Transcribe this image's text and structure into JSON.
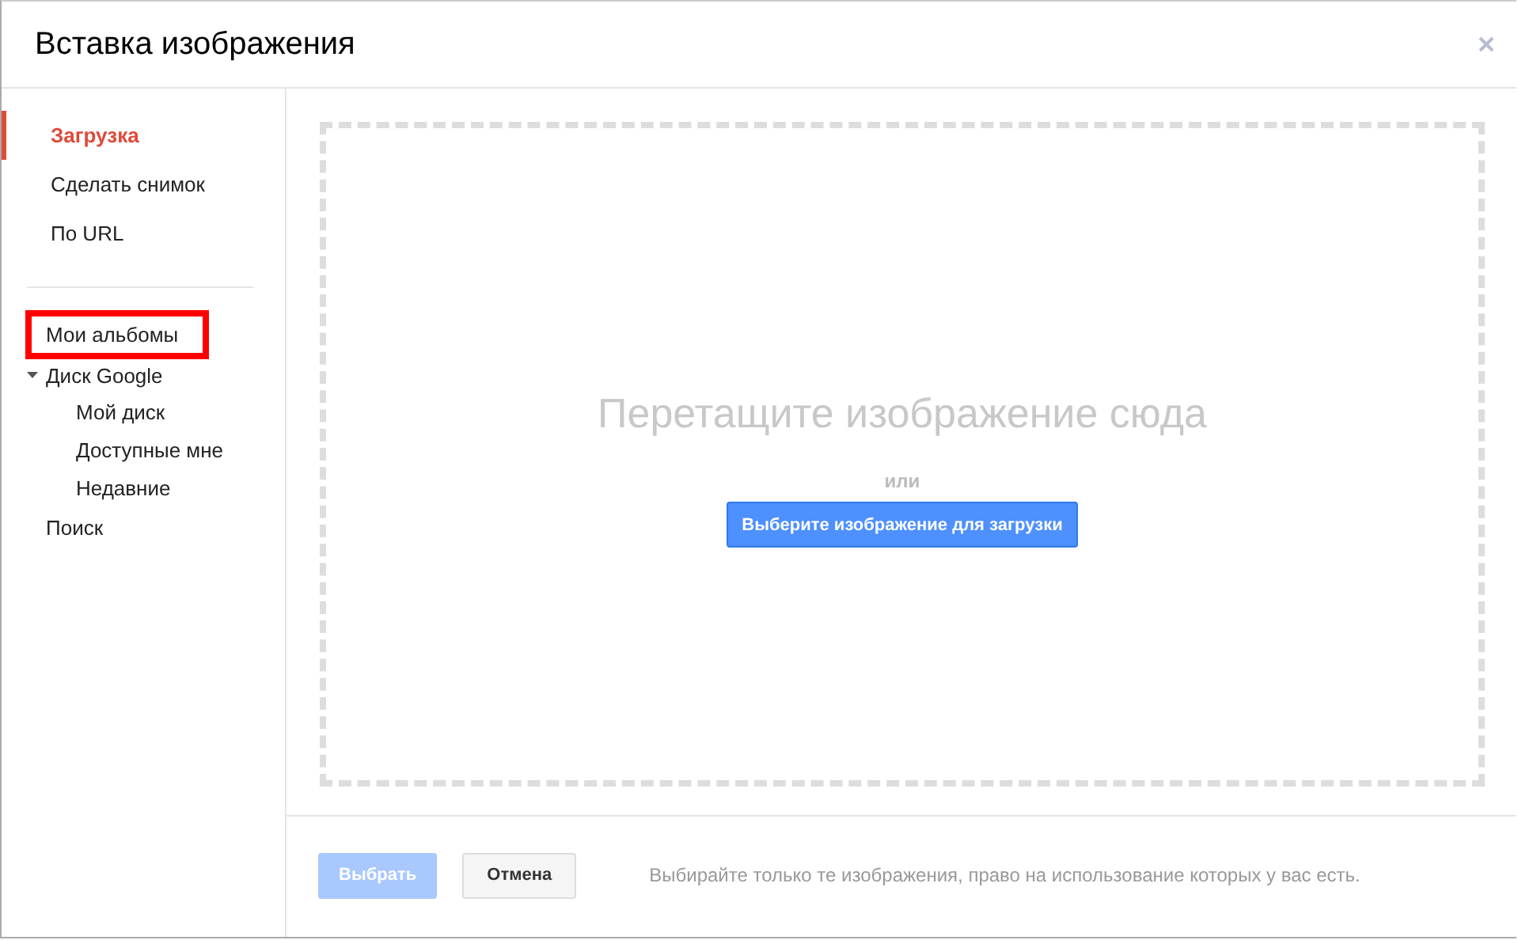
{
  "window": {
    "title": "Вставка изображения"
  },
  "sources": [
    {
      "label": "Загрузка",
      "selected": true
    },
    {
      "label": "Сделать снимок",
      "selected": false
    },
    {
      "label": "По URL",
      "selected": false
    }
  ],
  "library": [
    {
      "label": "Мои альбомы",
      "highlighted": true
    },
    {
      "label": "Диск Google",
      "highlighted": false,
      "expanded": true,
      "children": [
        {
          "label": "Мой диск"
        },
        {
          "label": "Доступные мне"
        },
        {
          "label": "Недавние"
        }
      ]
    },
    {
      "label": "Поиск",
      "highlighted": false
    }
  ],
  "drop_area": {
    "heading": "Перетащите изображение сюда",
    "separator": "или",
    "button": "Выберите изображение для загрузки"
  },
  "footer": {
    "buttons": [
      {
        "label": "Выбрать",
        "kind": "primary",
        "disabled": true
      },
      {
        "label": "Отмена",
        "kind": "secondary",
        "disabled": false
      }
    ],
    "note": "Выбирайте только те изображения, право на использование которых у вас есть."
  }
}
